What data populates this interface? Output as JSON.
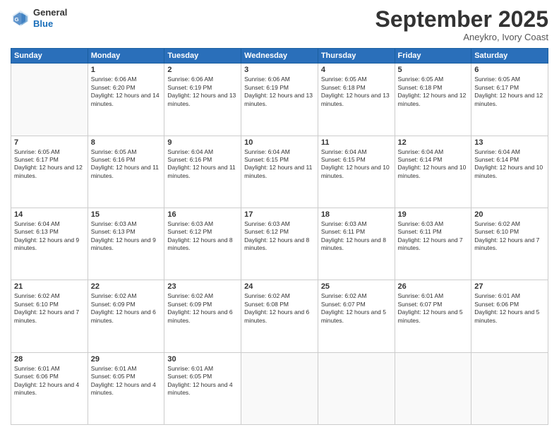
{
  "header": {
    "logo": {
      "general": "General",
      "blue": "Blue"
    },
    "title": "September 2025",
    "location": "Aneykro, Ivory Coast"
  },
  "calendar": {
    "days_of_week": [
      "Sunday",
      "Monday",
      "Tuesday",
      "Wednesday",
      "Thursday",
      "Friday",
      "Saturday"
    ],
    "weeks": [
      [
        {
          "num": "",
          "sunrise": "",
          "sunset": "",
          "daylight": "",
          "empty": true
        },
        {
          "num": "1",
          "sunrise": "Sunrise: 6:06 AM",
          "sunset": "Sunset: 6:20 PM",
          "daylight": "Daylight: 12 hours and 14 minutes."
        },
        {
          "num": "2",
          "sunrise": "Sunrise: 6:06 AM",
          "sunset": "Sunset: 6:19 PM",
          "daylight": "Daylight: 12 hours and 13 minutes."
        },
        {
          "num": "3",
          "sunrise": "Sunrise: 6:06 AM",
          "sunset": "Sunset: 6:19 PM",
          "daylight": "Daylight: 12 hours and 13 minutes."
        },
        {
          "num": "4",
          "sunrise": "Sunrise: 6:05 AM",
          "sunset": "Sunset: 6:18 PM",
          "daylight": "Daylight: 12 hours and 13 minutes."
        },
        {
          "num": "5",
          "sunrise": "Sunrise: 6:05 AM",
          "sunset": "Sunset: 6:18 PM",
          "daylight": "Daylight: 12 hours and 12 minutes."
        },
        {
          "num": "6",
          "sunrise": "Sunrise: 6:05 AM",
          "sunset": "Sunset: 6:17 PM",
          "daylight": "Daylight: 12 hours and 12 minutes."
        }
      ],
      [
        {
          "num": "7",
          "sunrise": "Sunrise: 6:05 AM",
          "sunset": "Sunset: 6:17 PM",
          "daylight": "Daylight: 12 hours and 12 minutes."
        },
        {
          "num": "8",
          "sunrise": "Sunrise: 6:05 AM",
          "sunset": "Sunset: 6:16 PM",
          "daylight": "Daylight: 12 hours and 11 minutes."
        },
        {
          "num": "9",
          "sunrise": "Sunrise: 6:04 AM",
          "sunset": "Sunset: 6:16 PM",
          "daylight": "Daylight: 12 hours and 11 minutes."
        },
        {
          "num": "10",
          "sunrise": "Sunrise: 6:04 AM",
          "sunset": "Sunset: 6:15 PM",
          "daylight": "Daylight: 12 hours and 11 minutes."
        },
        {
          "num": "11",
          "sunrise": "Sunrise: 6:04 AM",
          "sunset": "Sunset: 6:15 PM",
          "daylight": "Daylight: 12 hours and 10 minutes."
        },
        {
          "num": "12",
          "sunrise": "Sunrise: 6:04 AM",
          "sunset": "Sunset: 6:14 PM",
          "daylight": "Daylight: 12 hours and 10 minutes."
        },
        {
          "num": "13",
          "sunrise": "Sunrise: 6:04 AM",
          "sunset": "Sunset: 6:14 PM",
          "daylight": "Daylight: 12 hours and 10 minutes."
        }
      ],
      [
        {
          "num": "14",
          "sunrise": "Sunrise: 6:04 AM",
          "sunset": "Sunset: 6:13 PM",
          "daylight": "Daylight: 12 hours and 9 minutes."
        },
        {
          "num": "15",
          "sunrise": "Sunrise: 6:03 AM",
          "sunset": "Sunset: 6:13 PM",
          "daylight": "Daylight: 12 hours and 9 minutes."
        },
        {
          "num": "16",
          "sunrise": "Sunrise: 6:03 AM",
          "sunset": "Sunset: 6:12 PM",
          "daylight": "Daylight: 12 hours and 8 minutes."
        },
        {
          "num": "17",
          "sunrise": "Sunrise: 6:03 AM",
          "sunset": "Sunset: 6:12 PM",
          "daylight": "Daylight: 12 hours and 8 minutes."
        },
        {
          "num": "18",
          "sunrise": "Sunrise: 6:03 AM",
          "sunset": "Sunset: 6:11 PM",
          "daylight": "Daylight: 12 hours and 8 minutes."
        },
        {
          "num": "19",
          "sunrise": "Sunrise: 6:03 AM",
          "sunset": "Sunset: 6:11 PM",
          "daylight": "Daylight: 12 hours and 7 minutes."
        },
        {
          "num": "20",
          "sunrise": "Sunrise: 6:02 AM",
          "sunset": "Sunset: 6:10 PM",
          "daylight": "Daylight: 12 hours and 7 minutes."
        }
      ],
      [
        {
          "num": "21",
          "sunrise": "Sunrise: 6:02 AM",
          "sunset": "Sunset: 6:10 PM",
          "daylight": "Daylight: 12 hours and 7 minutes."
        },
        {
          "num": "22",
          "sunrise": "Sunrise: 6:02 AM",
          "sunset": "Sunset: 6:09 PM",
          "daylight": "Daylight: 12 hours and 6 minutes."
        },
        {
          "num": "23",
          "sunrise": "Sunrise: 6:02 AM",
          "sunset": "Sunset: 6:09 PM",
          "daylight": "Daylight: 12 hours and 6 minutes."
        },
        {
          "num": "24",
          "sunrise": "Sunrise: 6:02 AM",
          "sunset": "Sunset: 6:08 PM",
          "daylight": "Daylight: 12 hours and 6 minutes."
        },
        {
          "num": "25",
          "sunrise": "Sunrise: 6:02 AM",
          "sunset": "Sunset: 6:07 PM",
          "daylight": "Daylight: 12 hours and 5 minutes."
        },
        {
          "num": "26",
          "sunrise": "Sunrise: 6:01 AM",
          "sunset": "Sunset: 6:07 PM",
          "daylight": "Daylight: 12 hours and 5 minutes."
        },
        {
          "num": "27",
          "sunrise": "Sunrise: 6:01 AM",
          "sunset": "Sunset: 6:06 PM",
          "daylight": "Daylight: 12 hours and 5 minutes."
        }
      ],
      [
        {
          "num": "28",
          "sunrise": "Sunrise: 6:01 AM",
          "sunset": "Sunset: 6:06 PM",
          "daylight": "Daylight: 12 hours and 4 minutes."
        },
        {
          "num": "29",
          "sunrise": "Sunrise: 6:01 AM",
          "sunset": "Sunset: 6:05 PM",
          "daylight": "Daylight: 12 hours and 4 minutes."
        },
        {
          "num": "30",
          "sunrise": "Sunrise: 6:01 AM",
          "sunset": "Sunset: 6:05 PM",
          "daylight": "Daylight: 12 hours and 4 minutes."
        },
        {
          "num": "",
          "sunrise": "",
          "sunset": "",
          "daylight": "",
          "empty": true
        },
        {
          "num": "",
          "sunrise": "",
          "sunset": "",
          "daylight": "",
          "empty": true
        },
        {
          "num": "",
          "sunrise": "",
          "sunset": "",
          "daylight": "",
          "empty": true
        },
        {
          "num": "",
          "sunrise": "",
          "sunset": "",
          "daylight": "",
          "empty": true
        }
      ]
    ]
  }
}
